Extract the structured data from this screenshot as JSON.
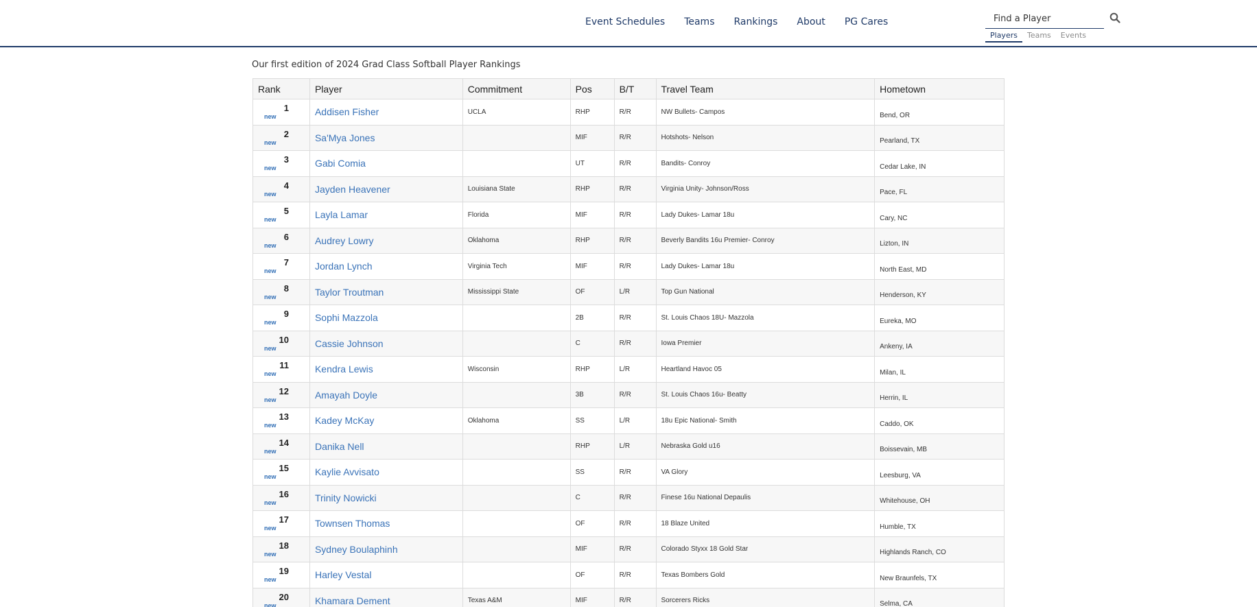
{
  "nav": {
    "items": [
      "Event Schedules",
      "Teams",
      "Rankings",
      "About",
      "PG Cares"
    ]
  },
  "search": {
    "placeholder": "Find a Player",
    "icon": "search-icon",
    "tabs": [
      "Players",
      "Teams",
      "Events"
    ],
    "active_tab": "Players"
  },
  "intro": "Our first edition of 2024 Grad Class Softball Player Rankings",
  "table": {
    "headers": [
      "Rank",
      "Player",
      "Commitment",
      "Pos",
      "B/T",
      "Travel Team",
      "Hometown"
    ],
    "badge_label": "new",
    "rows": [
      {
        "rank": "1",
        "player": "Addisen Fisher",
        "commitment": "UCLA",
        "pos": "RHP",
        "bt": "R/R",
        "team": "NW Bullets- Campos",
        "hometown": "Bend, OR"
      },
      {
        "rank": "2",
        "player": "Sa'Mya Jones",
        "commitment": "",
        "pos": "MIF",
        "bt": "R/R",
        "team": "Hotshots- Nelson",
        "hometown": "Pearland, TX"
      },
      {
        "rank": "3",
        "player": "Gabi Comia",
        "commitment": "",
        "pos": "UT",
        "bt": "R/R",
        "team": "Bandits- Conroy",
        "hometown": "Cedar Lake, IN"
      },
      {
        "rank": "4",
        "player": "Jayden Heavener",
        "commitment": "Louisiana State",
        "pos": "RHP",
        "bt": "R/R",
        "team": "Virginia Unity- Johnson/Ross",
        "hometown": "Pace, FL"
      },
      {
        "rank": "5",
        "player": "Layla Lamar",
        "commitment": "Florida",
        "pos": "MIF",
        "bt": "R/R",
        "team": "Lady Dukes- Lamar 18u",
        "hometown": "Cary, NC"
      },
      {
        "rank": "6",
        "player": "Audrey Lowry",
        "commitment": "Oklahoma",
        "pos": "RHP",
        "bt": "R/R",
        "team": "Beverly Bandits 16u Premier- Conroy",
        "hometown": "Lizton, IN"
      },
      {
        "rank": "7",
        "player": "Jordan Lynch",
        "commitment": "Virginia Tech",
        "pos": "MIF",
        "bt": "R/R",
        "team": "Lady Dukes- Lamar 18u",
        "hometown": "North East, MD"
      },
      {
        "rank": "8",
        "player": "Taylor Troutman",
        "commitment": "Mississippi State",
        "pos": "OF",
        "bt": "L/R",
        "team": "Top Gun National",
        "hometown": "Henderson, KY"
      },
      {
        "rank": "9",
        "player": "Sophi Mazzola",
        "commitment": "",
        "pos": "2B",
        "bt": "R/R",
        "team": "St. Louis Chaos 18U- Mazzola",
        "hometown": "Eureka, MO"
      },
      {
        "rank": "10",
        "player": "Cassie Johnson",
        "commitment": "",
        "pos": "C",
        "bt": "R/R",
        "team": "Iowa Premier",
        "hometown": "Ankeny, IA"
      },
      {
        "rank": "11",
        "player": "Kendra Lewis",
        "commitment": "Wisconsin",
        "pos": "RHP",
        "bt": "L/R",
        "team": "Heartland Havoc 05",
        "hometown": "Milan, IL"
      },
      {
        "rank": "12",
        "player": "Amayah Doyle",
        "commitment": "",
        "pos": "3B",
        "bt": "R/R",
        "team": "St. Louis Chaos 16u- Beatty",
        "hometown": "Herrin, IL"
      },
      {
        "rank": "13",
        "player": "Kadey McKay",
        "commitment": "Oklahoma",
        "pos": "SS",
        "bt": "L/R",
        "team": "18u Epic National- Smith",
        "hometown": "Caddo, OK"
      },
      {
        "rank": "14",
        "player": "Danika Nell",
        "commitment": "",
        "pos": "RHP",
        "bt": "L/R",
        "team": "Nebraska Gold u16",
        "hometown": "Boissevain, MB"
      },
      {
        "rank": "15",
        "player": "Kaylie Avvisato",
        "commitment": "",
        "pos": "SS",
        "bt": "R/R",
        "team": "VA Glory",
        "hometown": "Leesburg, VA"
      },
      {
        "rank": "16",
        "player": "Trinity Nowicki",
        "commitment": "",
        "pos": "C",
        "bt": "R/R",
        "team": "Finese 16u National Depaulis",
        "hometown": "Whitehouse, OH"
      },
      {
        "rank": "17",
        "player": "Townsen Thomas",
        "commitment": "",
        "pos": "OF",
        "bt": "R/R",
        "team": "18 Blaze United",
        "hometown": "Humble, TX"
      },
      {
        "rank": "18",
        "player": "Sydney Boulaphinh",
        "commitment": "",
        "pos": "MIF",
        "bt": "R/R",
        "team": "Colorado Styxx 18 Gold Star",
        "hometown": "Highlands Ranch, CO"
      },
      {
        "rank": "19",
        "player": "Harley Vestal",
        "commitment": "",
        "pos": "OF",
        "bt": "R/R",
        "team": "Texas Bombers Gold",
        "hometown": "New Braunfels, TX"
      },
      {
        "rank": "20",
        "player": "Khamara Dement",
        "commitment": "Texas A&M",
        "pos": "MIF",
        "bt": "R/R",
        "team": "Sorcerers Ricks",
        "hometown": "Selma, CA"
      }
    ]
  }
}
